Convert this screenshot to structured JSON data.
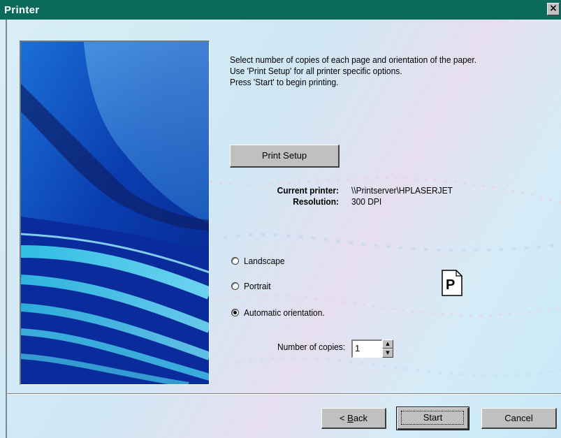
{
  "window": {
    "title": "Printer",
    "close_glyph": "×"
  },
  "instructions": [
    "Select number of copies of each page and orientation of the paper.",
    "Use 'Print Setup' for all printer specific options.",
    "Press 'Start' to begin printing."
  ],
  "print_setup_label": "Print Setup",
  "printer_info": {
    "current_printer_label": "Current printer:",
    "current_printer_value": "\\\\Printserver\\HPLASERJET",
    "resolution_label": "Resolution:",
    "resolution_value": "300 DPI"
  },
  "orientation": {
    "options": [
      "Landscape",
      "Portrait",
      "Automatic orientation."
    ],
    "selected": "Automatic orientation.",
    "preview_letter": "P"
  },
  "copies": {
    "label": "Number of copies:",
    "value": "1"
  },
  "footer": {
    "back_prefix": "< ",
    "back_accel": "B",
    "back_rest": "ack",
    "start_label": "Start",
    "cancel_label": "Cancel"
  },
  "icons": {
    "close": "close-icon",
    "spin_up": "arrow-up-icon",
    "spin_down": "arrow-down-icon",
    "orientation": "page-portrait-icon"
  },
  "colors": {
    "title_bar": "#0a6b5a",
    "button_face": "#c0c0c0",
    "panel_bg": "#d4ecf7"
  }
}
